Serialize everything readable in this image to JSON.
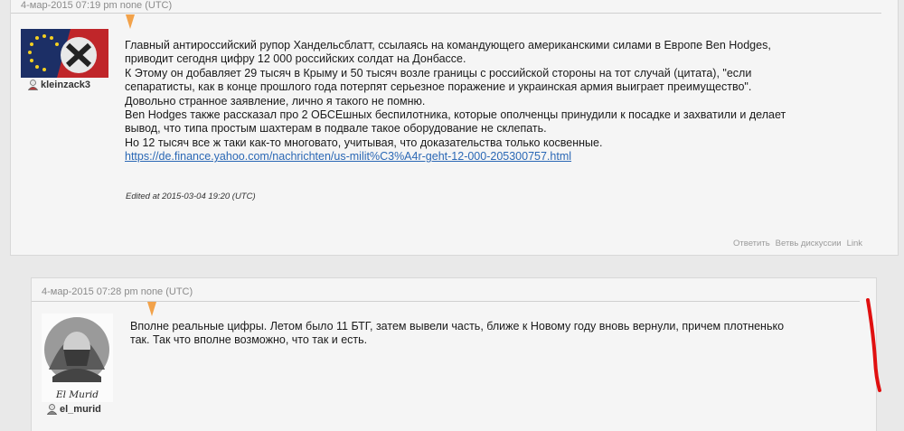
{
  "comments": [
    {
      "timestamp": "4-мар-2015 07:19 pm",
      "ip": "none (UTC)",
      "username": "kleinzack3",
      "lines": [
        "Главный антироссийский рупор Хандельсблатт, ссылаясь на командующего американскими силами в Европе Ben Hodges,",
        "приводит сегодня цифру 12 000 российских солдат на Донбассе.",
        "К Этому он добавляет 29 тысяч в Крыму и 50 тысяч возле границы с российской стороны на тот случай (цитата), \"если",
        "сепаратисты, как в конце прошлого года потерпят серьезное поражение и украинская армия выиграет преимущество\".",
        "Довольно странное заявление, лично я такого не помню.",
        "Ben Hodges также рассказал про 2 ОБСЕшных беспилотника, которые ополченцы принудили к посадке и захватили и делает",
        "вывод, что типа простым шахтерам в подвале такое оборудование не склепать.",
        "Но 12 тысяч все ж таки как-то многовато, учитывая, что доказательства только косвенные."
      ],
      "link": "https://de.finance.yahoo.com/nachrichten/us-milit%C3%A4r-geht-12-000-205300757.html",
      "edited": "Edited at 2015-03-04 19:20 (UTC)",
      "actions": {
        "reply": "Ответить",
        "thread": "Ветвь дискуссии",
        "link": "Link"
      }
    },
    {
      "timestamp": "4-мар-2015 07:28 pm",
      "ip": "none (UTC)",
      "username": "el_murid",
      "signature": "El Murid",
      "lines": [
        "Вполне реальные цифры. Летом было 11 БТГ, затем вывели часть, ближе к Новому году вновь вернули, причем плотненько",
        "так. Так что вполне возможно, что так и есть."
      ]
    }
  ],
  "colors": {
    "accent": "#f2a24a",
    "link": "#2b68b5",
    "mark": "#e01010"
  },
  "icons": {
    "user": "user-icon",
    "userpic1": "flag-userpic",
    "userpic2": "hooded-figure-userpic"
  }
}
